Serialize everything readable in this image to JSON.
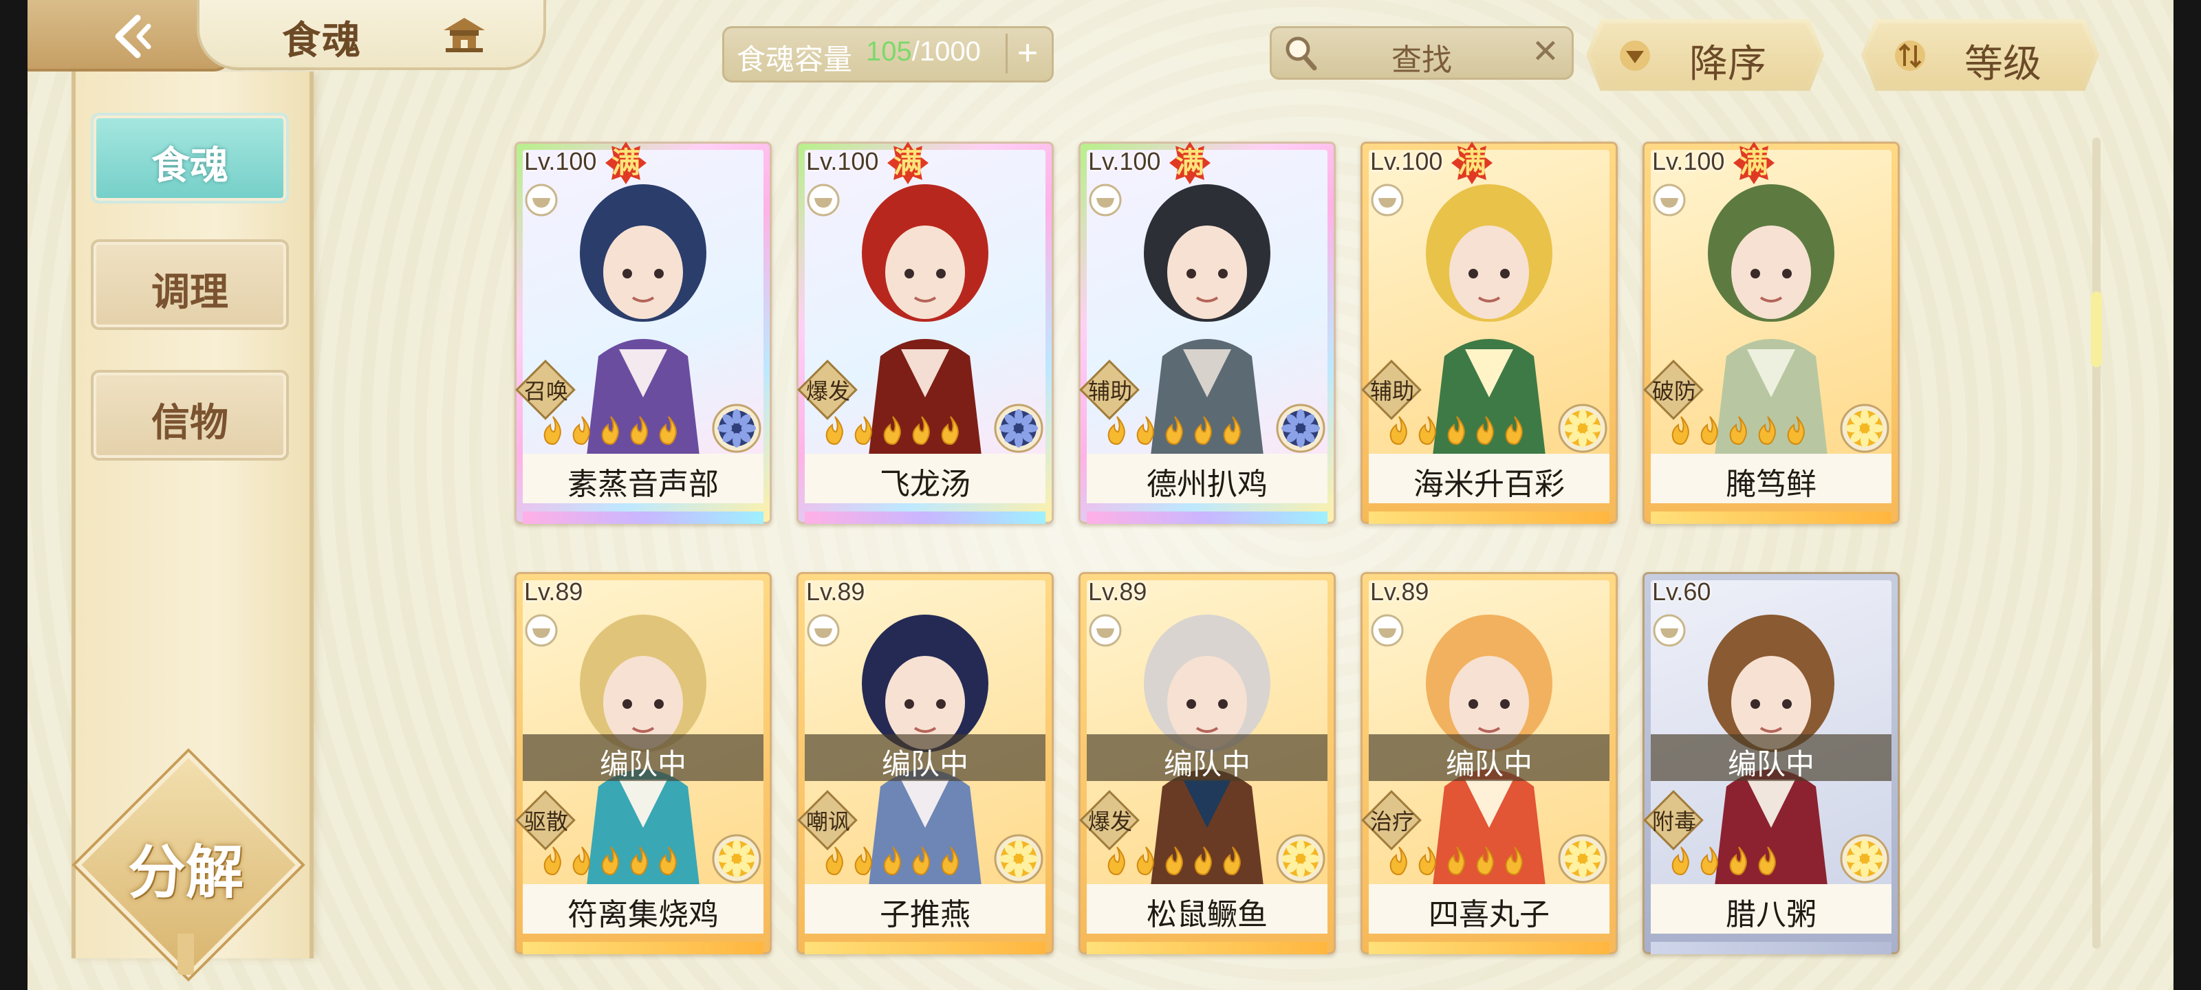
{
  "header": {
    "title": "食魂",
    "capacity_label": "食魂容量",
    "capacity_current": "105",
    "capacity_max": "/1000",
    "capacity_add": "+",
    "search_label": "查找",
    "close_glyph": "✕",
    "sort_order_label": "降序",
    "sort_key_label": "等级"
  },
  "sidebar": {
    "tabs": [
      {
        "label": "食魂",
        "active": true
      },
      {
        "label": "调理",
        "active": false
      },
      {
        "label": "信物",
        "active": false
      }
    ],
    "decompose_label": "分解"
  },
  "cards": [
    {
      "level": "Lv.100",
      "full_badge": "满",
      "role": "召唤",
      "stars": 5,
      "name": "素蒸音声部",
      "frame": "rainbow",
      "medal": "lotus-blue",
      "team": ""
    },
    {
      "level": "Lv.100",
      "full_badge": "满",
      "role": "爆发",
      "stars": 5,
      "name": "飞龙汤",
      "frame": "rainbow",
      "medal": "lotus-blue",
      "team": ""
    },
    {
      "level": "Lv.100",
      "full_badge": "满",
      "role": "辅助",
      "stars": 5,
      "name": "德州扒鸡",
      "frame": "rainbow",
      "medal": "lotus-blue",
      "team": ""
    },
    {
      "level": "Lv.100",
      "full_badge": "满",
      "role": "辅助",
      "stars": 5,
      "name": "海米升百彩",
      "frame": "gold",
      "medal": "flower-gold",
      "team": ""
    },
    {
      "level": "Lv.100",
      "full_badge": "满",
      "role": "破防",
      "stars": 5,
      "name": "腌笃鲜",
      "frame": "gold",
      "medal": "flower-gold",
      "team": ""
    },
    {
      "level": "Lv.89",
      "full_badge": "",
      "role": "驱散",
      "stars": 5,
      "name": "符离集烧鸡",
      "frame": "gold",
      "medal": "flower-gold",
      "team": "编队中"
    },
    {
      "level": "Lv.89",
      "full_badge": "",
      "role": "嘲讽",
      "stars": 5,
      "name": "子推燕",
      "frame": "gold",
      "medal": "flower-gold",
      "team": "编队中"
    },
    {
      "level": "Lv.89",
      "full_badge": "",
      "role": "爆发",
      "stars": 5,
      "name": "松鼠鳜鱼",
      "frame": "gold",
      "medal": "flower-gold",
      "team": "编队中"
    },
    {
      "level": "Lv.89",
      "full_badge": "",
      "role": "治疗",
      "stars": 5,
      "name": "四喜丸子",
      "frame": "gold",
      "medal": "flower-gold",
      "team": "编队中"
    },
    {
      "level": "Lv.60",
      "full_badge": "",
      "role": "附毒",
      "stars": 4,
      "name": "腊八粥",
      "frame": "silver",
      "medal": "flower-gold",
      "team": "编队中"
    }
  ],
  "colors": {
    "capacity_current": "#7cd96b",
    "active_tab": "#8fdcd5",
    "full_badge": "#e03a24"
  },
  "icons": [
    "back-arrow-icon",
    "pagoda-icon",
    "search-icon",
    "close-icon",
    "sort-desc-icon",
    "sort-level-icon",
    "bowl-icon",
    "flame-icon",
    "medal-icon"
  ]
}
